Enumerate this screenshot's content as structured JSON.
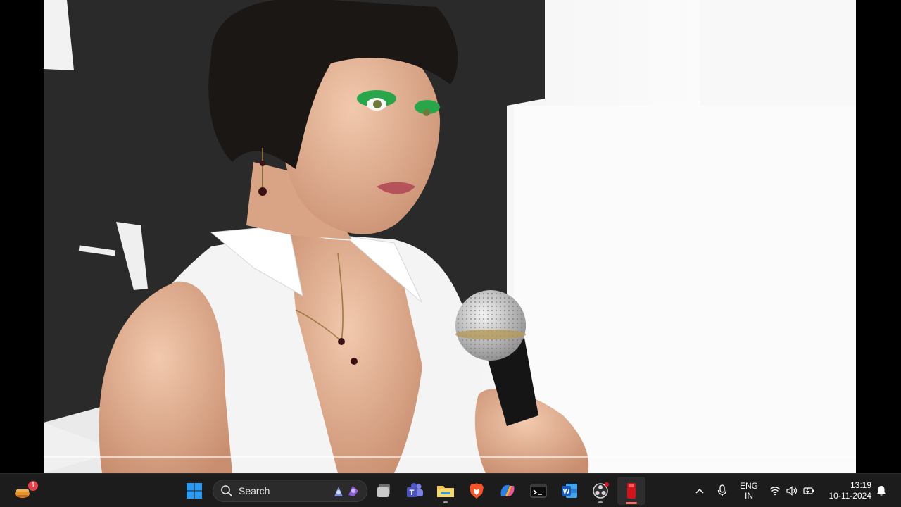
{
  "screen": {
    "content_type": "fullscreen-rendered-scene",
    "scene_description_visible": "woman holding microphone"
  },
  "taskbar": {
    "widget_badge": "1",
    "search": {
      "label": "Search"
    },
    "apps": [
      {
        "name": "start",
        "icon": "windows-logo-icon"
      },
      {
        "name": "search",
        "icon": "search-icon"
      },
      {
        "name": "task-view",
        "icon": "task-view-icon"
      },
      {
        "name": "teams",
        "icon": "teams-icon"
      },
      {
        "name": "file-explorer",
        "icon": "folder-icon"
      },
      {
        "name": "brave",
        "icon": "brave-lion-icon"
      },
      {
        "name": "copilot",
        "icon": "copilot-icon"
      },
      {
        "name": "terminal",
        "icon": "terminal-icon"
      },
      {
        "name": "word",
        "icon": "word-icon"
      },
      {
        "name": "obs",
        "icon": "obs-icon"
      },
      {
        "name": "game",
        "icon": "red-app-icon"
      }
    ],
    "tray": {
      "language_line1": "ENG",
      "language_line2": "IN",
      "time": "13:19",
      "date": "10-11-2024"
    }
  },
  "colors": {
    "taskbar_bg": "#1c1c1c",
    "accent_blue": "#0a84ff",
    "windows_blue": "#2b9af3",
    "folder_yellow": "#f2c94c",
    "brave_orange": "#fb542b",
    "word_blue": "#185abd",
    "app_red": "#d1141b"
  }
}
